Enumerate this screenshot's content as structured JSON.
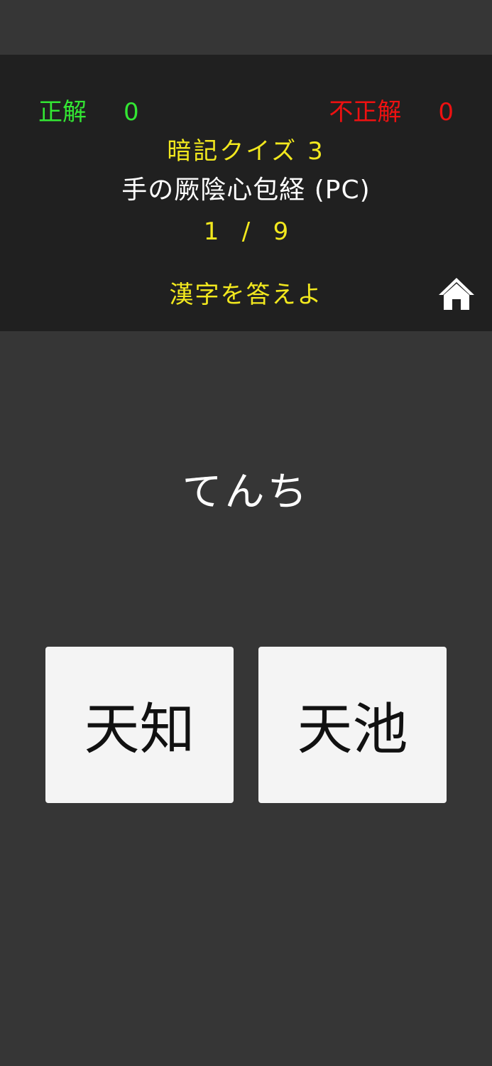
{
  "header": {
    "correct_label": "正解",
    "correct_count": "0",
    "wrong_label": "不正解",
    "wrong_count": "0",
    "quiz_title": "暗記クイズ 3",
    "chapter_title": "手の厥陰心包経 (PC)",
    "progress": "1   /   9",
    "instruction": "漢字を答えよ",
    "home_icon": "home-icon"
  },
  "question": {
    "reading": "てんち"
  },
  "answers": [
    {
      "label": "天知"
    },
    {
      "label": "天池"
    }
  ],
  "colors": {
    "background": "#363636",
    "header_background": "#202020",
    "correct": "#33e633",
    "wrong": "#ee1111",
    "accent_yellow": "#f2e81e",
    "answer_button": "#f4f4f4"
  }
}
